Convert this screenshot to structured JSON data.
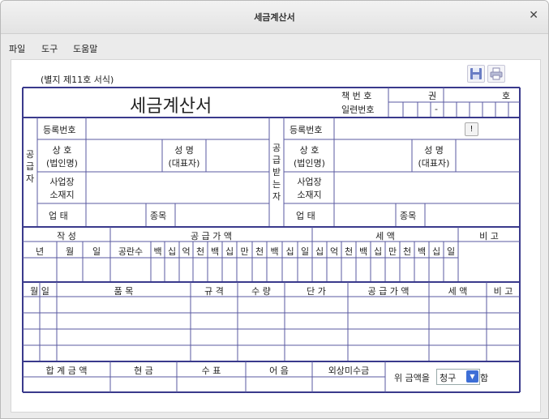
{
  "window": {
    "title": "세금계산서"
  },
  "menu": {
    "file": "파일",
    "tools": "도구",
    "help": "도움말"
  },
  "form": {
    "form_number": "(별지 제11호 서식)",
    "title": "세금계산서",
    "book_number_label": "책 번 호",
    "serial_label": "일련번호",
    "volume_label": "권",
    "ho_label": "호",
    "dash": "-"
  },
  "supplier": {
    "side_label": [
      "공",
      "급",
      "자"
    ],
    "reg_no": "등록번호",
    "company_line1": "상 호",
    "company_line2": "(법인명)",
    "name_line1": "성 명",
    "name_line2": "(대표자)",
    "address_line1": "사업장",
    "address_line2": "소재지",
    "business_type": "업 태",
    "item": "종목"
  },
  "receiver": {
    "side_label": [
      "공",
      "급",
      "받",
      "는",
      "자"
    ],
    "reg_no": "등록번호",
    "company_line1": "상 호",
    "company_line2": "(법인명)",
    "name_line1": "성 명",
    "name_line2": "(대표자)",
    "address_line1": "사업장",
    "address_line2": "소재지",
    "business_type": "업 태",
    "item": "종목",
    "check_button": "!"
  },
  "amount_header": {
    "written": "작 성",
    "supply": "공 급 가 액",
    "tax": "세 액",
    "note": "비 고",
    "year": "년",
    "month": "월",
    "day": "일",
    "blank": "공란수",
    "supply_digits": [
      "백",
      "십",
      "억",
      "천",
      "백",
      "십",
      "만",
      "천",
      "백",
      "십",
      "일"
    ],
    "tax_digits": [
      "십",
      "억",
      "천",
      "백",
      "십",
      "만",
      "천",
      "백",
      "십",
      "일"
    ]
  },
  "items_header": {
    "month_day": "월 일",
    "item": "품 목",
    "spec": "규 격",
    "qty": "수 량",
    "unit_price": "단 가",
    "supply": "공 급 가 액",
    "tax": "세 액",
    "note": "비 고"
  },
  "totals": {
    "total": "합 계 금 액",
    "cash": "현 금",
    "check": "수 표",
    "note": "어 음",
    "credit": "외상미수금",
    "claim_prefix": "위 금액을",
    "claim_value": "청구",
    "claim_suffix": "함"
  }
}
